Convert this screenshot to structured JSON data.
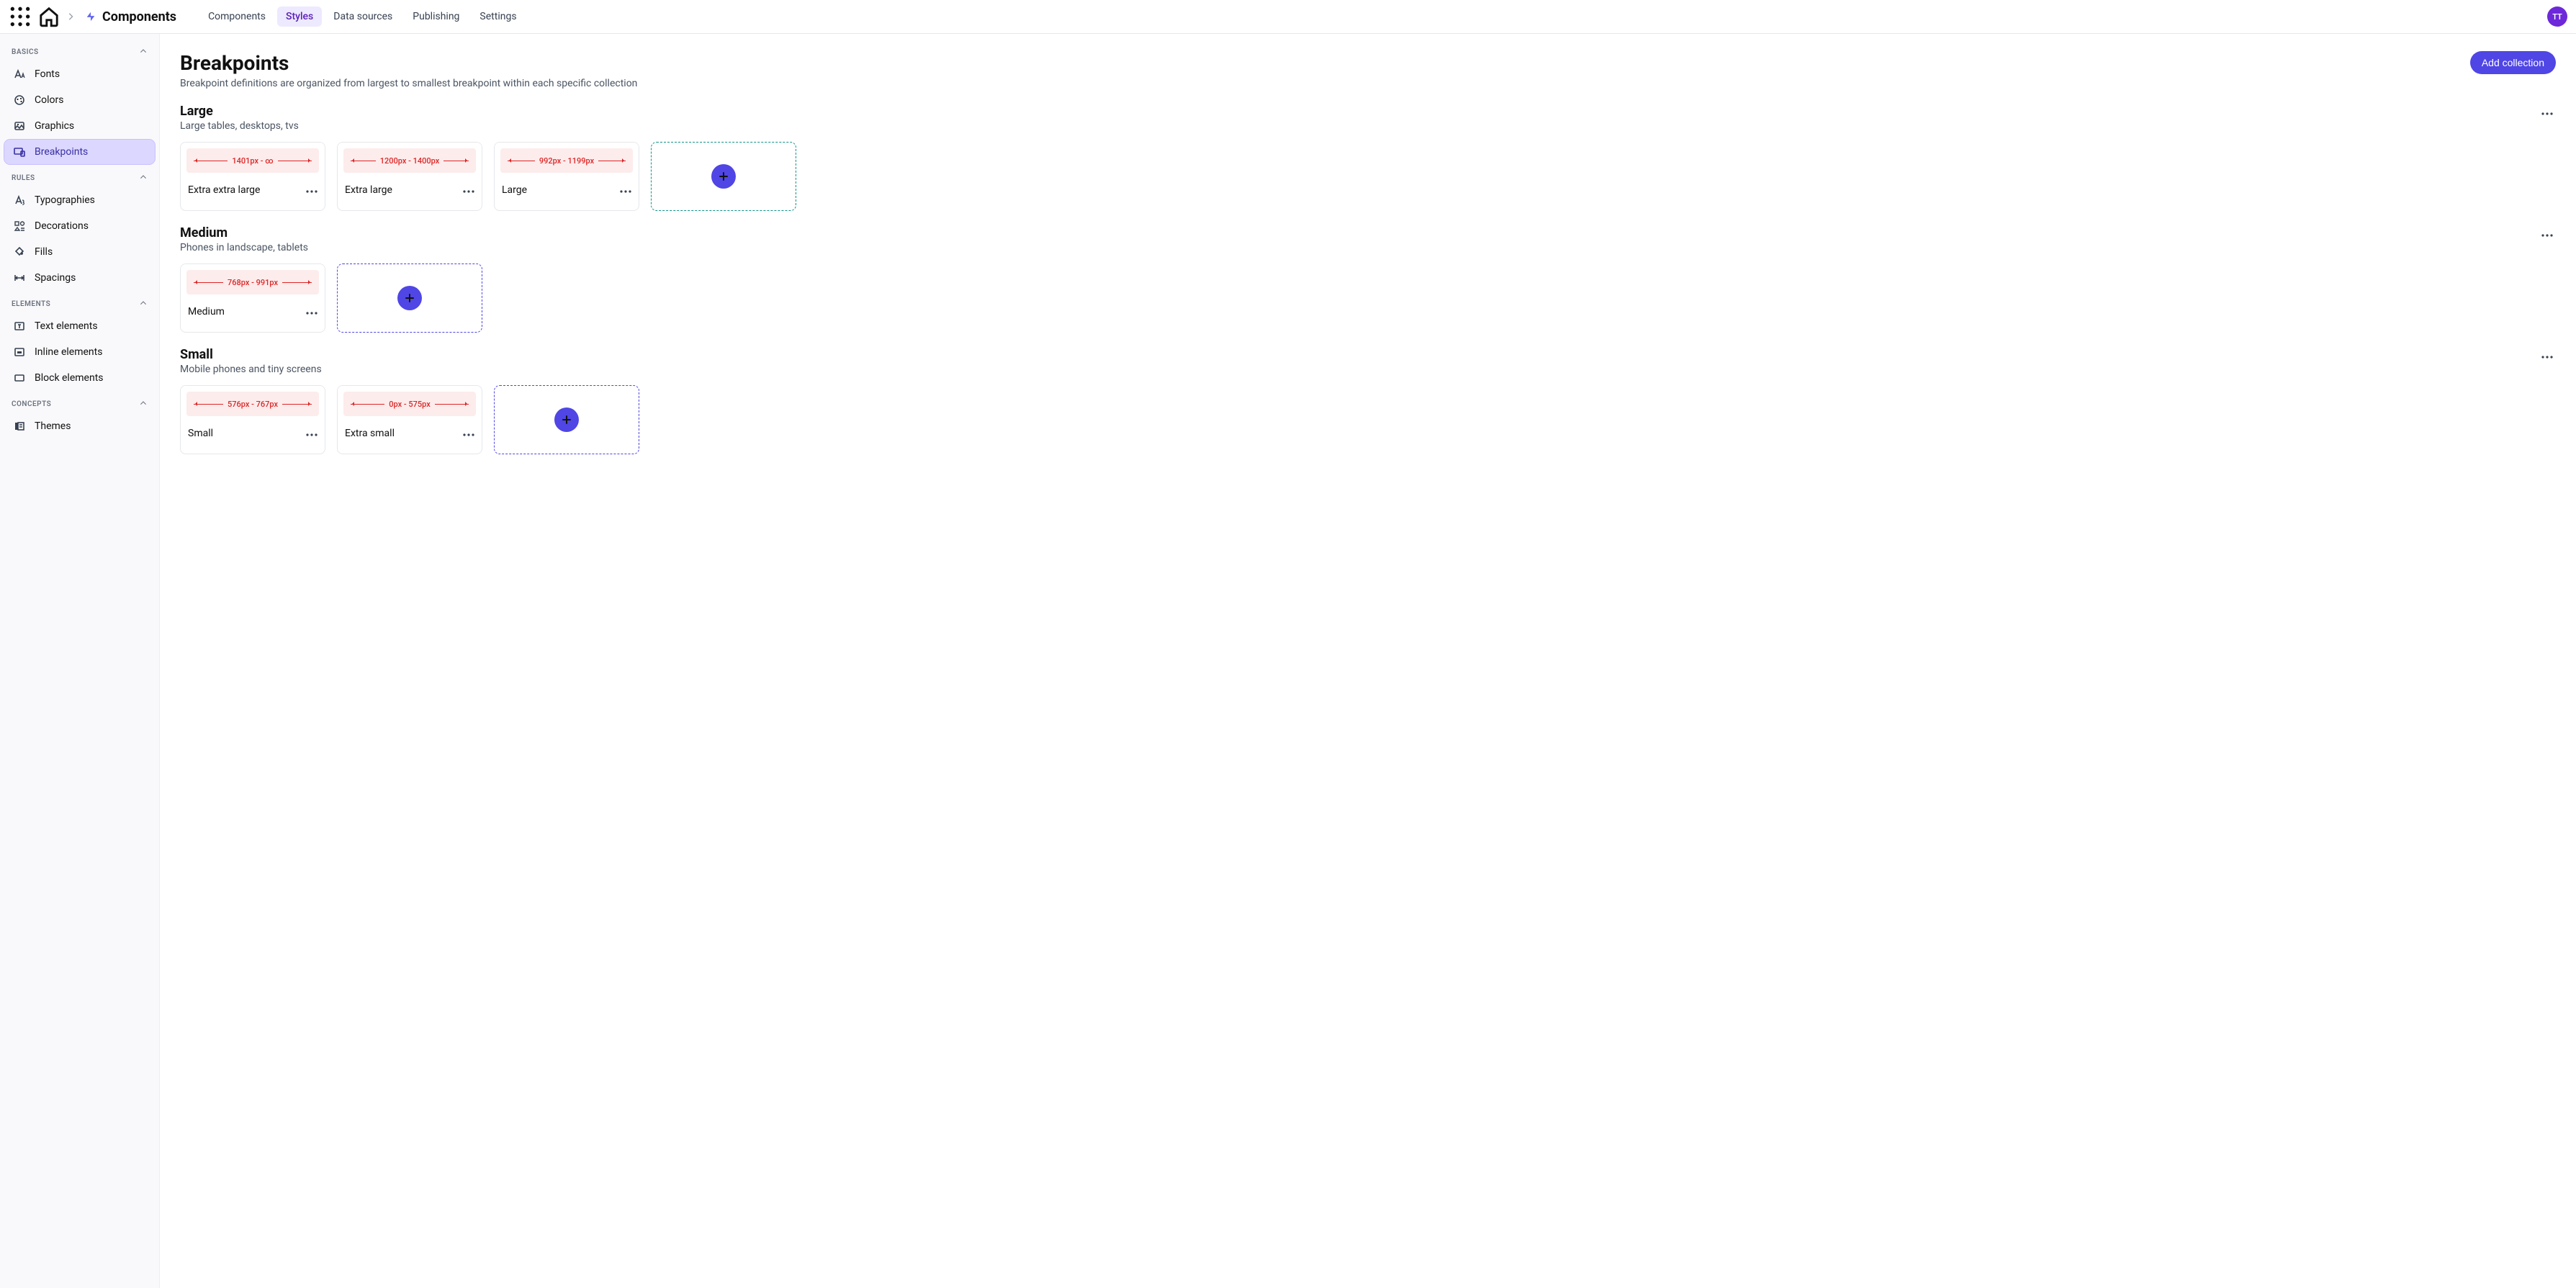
{
  "chrome": {
    "brand": "Components",
    "tabs": [
      "Components",
      "Styles",
      "Data sources",
      "Publishing",
      "Settings"
    ],
    "active_tab_index": 1,
    "avatar": "TT"
  },
  "sidebar": {
    "sections": [
      {
        "label": "BASICS",
        "items": [
          {
            "label": "Fonts",
            "icon": "fonts"
          },
          {
            "label": "Colors",
            "icon": "colors"
          },
          {
            "label": "Graphics",
            "icon": "graphics"
          },
          {
            "label": "Breakpoints",
            "icon": "breakpoints",
            "active": true
          }
        ]
      },
      {
        "label": "RULES",
        "items": [
          {
            "label": "Typographies",
            "icon": "typographies"
          },
          {
            "label": "Decorations",
            "icon": "decorations"
          },
          {
            "label": "Fills",
            "icon": "fills"
          },
          {
            "label": "Spacings",
            "icon": "spacings"
          }
        ]
      },
      {
        "label": "ELEMENTS",
        "items": [
          {
            "label": "Text elements",
            "icon": "text-elements"
          },
          {
            "label": "Inline elements",
            "icon": "inline-elements"
          },
          {
            "label": "Block elements",
            "icon": "block-elements"
          }
        ]
      },
      {
        "label": "CONCEPTS",
        "items": [
          {
            "label": "Themes",
            "icon": "themes"
          }
        ]
      }
    ]
  },
  "page": {
    "title": "Breakpoints",
    "description": "Breakpoint definitions are organized from largest to smallest breakpoint within each specific collection",
    "cta": "Add collection"
  },
  "collections": [
    {
      "name": "Large",
      "description": "Large tables, desktops, tvs",
      "add_style": "teal",
      "items": [
        {
          "name": "Extra extra large",
          "range": "1401px - ∞"
        },
        {
          "name": "Extra large",
          "range": "1200px - 1400px"
        },
        {
          "name": "Large",
          "range": "992px - 1199px"
        }
      ]
    },
    {
      "name": "Medium",
      "description": "Phones in landscape, tablets",
      "add_style": "indigo",
      "items": [
        {
          "name": "Medium",
          "range": "768px - 991px"
        }
      ]
    },
    {
      "name": "Small",
      "description": "Mobile phones and tiny screens",
      "add_style": "indigo",
      "items": [
        {
          "name": "Small",
          "range": "576px - 767px"
        },
        {
          "name": "Extra small",
          "range": "0px - 575px"
        }
      ]
    }
  ]
}
